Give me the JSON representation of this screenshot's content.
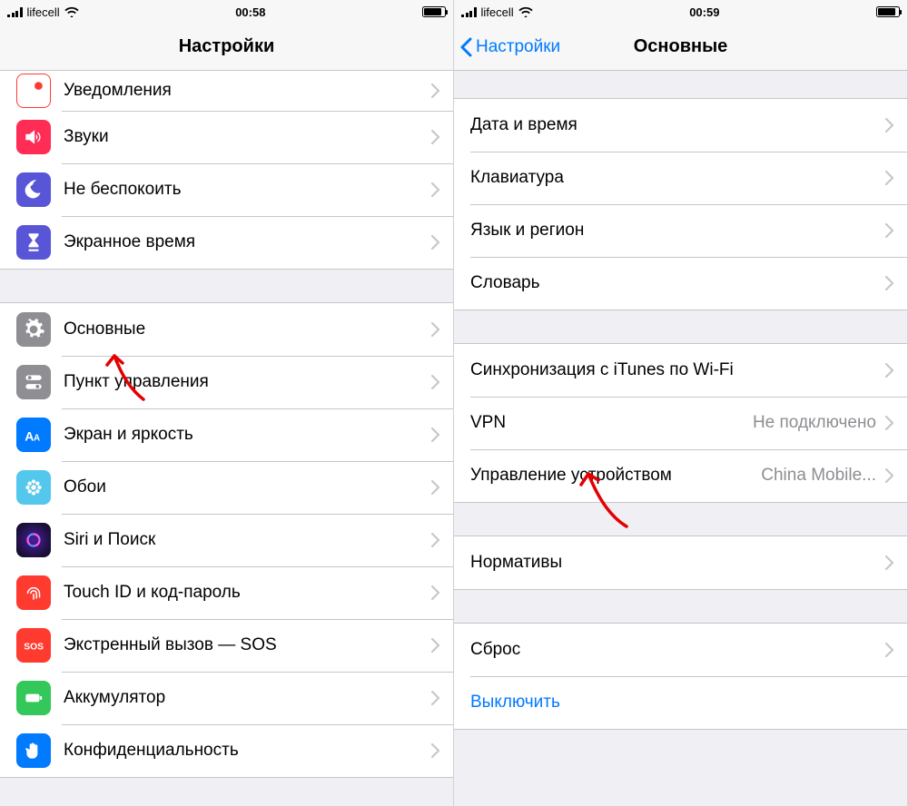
{
  "left": {
    "status": {
      "carrier": "lifecell",
      "time": "00:58"
    },
    "title": "Настройки",
    "group1": [
      {
        "key": "notifications",
        "label": "Уведомления",
        "color": "#ffffff",
        "iconBorder": "#ff3b30"
      },
      {
        "key": "sounds",
        "label": "Звуки",
        "color": "#ff2d55"
      },
      {
        "key": "dnd",
        "label": "Не беспокоить",
        "color": "#5856d6"
      },
      {
        "key": "screentime",
        "label": "Экранное время",
        "color": "#5856d6"
      }
    ],
    "group2": [
      {
        "key": "general",
        "label": "Основные",
        "color": "#8e8e93"
      },
      {
        "key": "controlcenter",
        "label": "Пункт управления",
        "color": "#8e8e93"
      },
      {
        "key": "display",
        "label": "Экран и яркость",
        "color": "#007aff"
      },
      {
        "key": "wallpaper",
        "label": "Обои",
        "color": "#54c7ec"
      },
      {
        "key": "siri",
        "label": "Siri и Поиск",
        "color": "#1c1c1e"
      },
      {
        "key": "touchid",
        "label": "Touch ID и код-пароль",
        "color": "#ff3b30"
      },
      {
        "key": "sos",
        "label": "Экстренный вызов — SOS",
        "color": "#ff3b30"
      },
      {
        "key": "battery",
        "label": "Аккумулятор",
        "color": "#34c759"
      },
      {
        "key": "privacy",
        "label": "Конфиденциальность",
        "color": "#007aff"
      }
    ]
  },
  "right": {
    "status": {
      "carrier": "lifecell",
      "time": "00:59"
    },
    "back": "Настройки",
    "title": "Основные",
    "group1": [
      {
        "key": "datetime",
        "label": "Дата и время"
      },
      {
        "key": "keyboard",
        "label": "Клавиатура"
      },
      {
        "key": "language",
        "label": "Язык и регион"
      },
      {
        "key": "dictionary",
        "label": "Словарь"
      }
    ],
    "group2": [
      {
        "key": "itunes",
        "label": "Синхронизация с iTunes по Wi-Fi"
      },
      {
        "key": "vpn",
        "label": "VPN",
        "detail": "Не подключено"
      },
      {
        "key": "device",
        "label": "Управление устройством",
        "detail": "China Mobile..."
      }
    ],
    "group3": [
      {
        "key": "regulatory",
        "label": "Нормативы"
      }
    ],
    "group4": [
      {
        "key": "reset",
        "label": "Сброс"
      },
      {
        "key": "shutdown",
        "label": "Выключить",
        "link": true,
        "nochev": true
      }
    ]
  }
}
